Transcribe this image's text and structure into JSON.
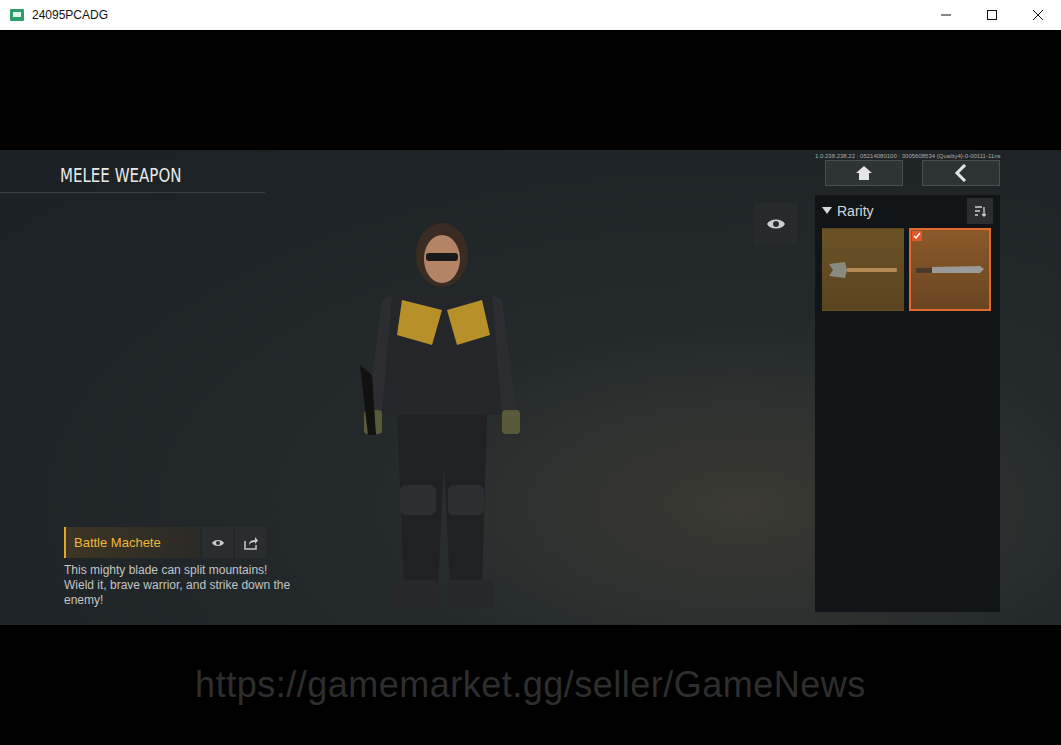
{
  "window": {
    "title": "24095PCADG"
  },
  "screen": {
    "title": "MELEE WEAPON",
    "build_info": "1.0.238.238.22 : 05214080100 : 3005608534 {Quality4}-0-00111-11ns"
  },
  "filter": {
    "label": "Rarity",
    "expanded": true
  },
  "items": [
    {
      "name": "Shovel",
      "selected": false,
      "kind": "shovel"
    },
    {
      "name": "Battle Machete",
      "selected": true,
      "kind": "machete"
    }
  ],
  "selected_item": {
    "name": "Battle Machete",
    "description": "This mighty blade can split mountains! Wield it, brave warrior, and strike down the enemy!"
  },
  "watermark": "https://gamemarket.gg/seller/GameNews"
}
